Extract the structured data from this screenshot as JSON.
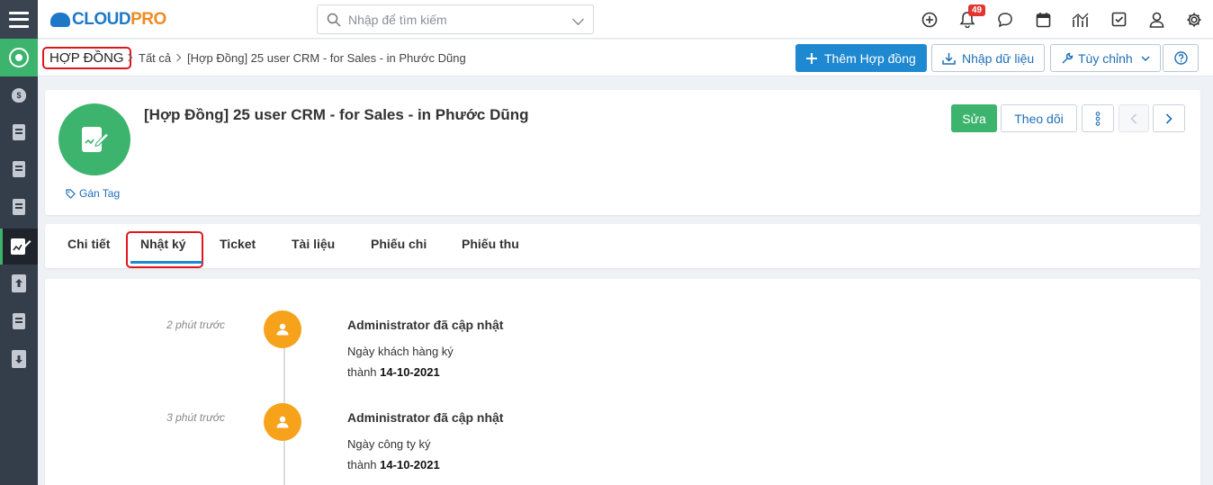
{
  "brand": {
    "cloud": "CLOUD",
    "pro": "PRO",
    "cloud_color": "#1e78c8",
    "pro_color": "#f08a24"
  },
  "search": {
    "placeholder": "Nhập để tìm kiếm"
  },
  "notifications": {
    "count": "49"
  },
  "colors": {
    "accent": "#1e88d0",
    "success": "#3cb46e",
    "sidebar": "#343d4a",
    "timeline_dot": "#f7a21b",
    "highlight": "#e0161d"
  },
  "breadcrumb": {
    "module": "HỢP ĐỒNG",
    "level1": "Tất cả",
    "level2": "[Hợp Đồng] 25 user CRM - for Sales - in Phước Dũng"
  },
  "toolbar": {
    "add_label": "Thêm Hợp đồng",
    "import_label": "Nhập dữ liệu",
    "customize_label": "Tùy chỉnh"
  },
  "record": {
    "title": "[Hợp Đồng] 25 user CRM - for Sales - in Phước Dũng",
    "tag_label": "Gán Tag",
    "edit_label": "Sửa",
    "follow_label": "Theo dõi"
  },
  "tabs": [
    {
      "label": "Chi tiết"
    },
    {
      "label": "Nhật ký"
    },
    {
      "label": "Ticket"
    },
    {
      "label": "Tài liệu"
    },
    {
      "label": "Phiếu chi"
    },
    {
      "label": "Phiếu thu"
    }
  ],
  "timeline": [
    {
      "time": "2 phút trước",
      "heading": "Administrator đã cập nhật",
      "field": "Ngày khách hàng ký",
      "value_prefix": "thành",
      "value": "14-10-2021"
    },
    {
      "time": "3 phút trước",
      "heading": "Administrator đã cập nhật",
      "field": "Ngày công ty ký",
      "value_prefix": "thành",
      "value": "14-10-2021"
    }
  ]
}
